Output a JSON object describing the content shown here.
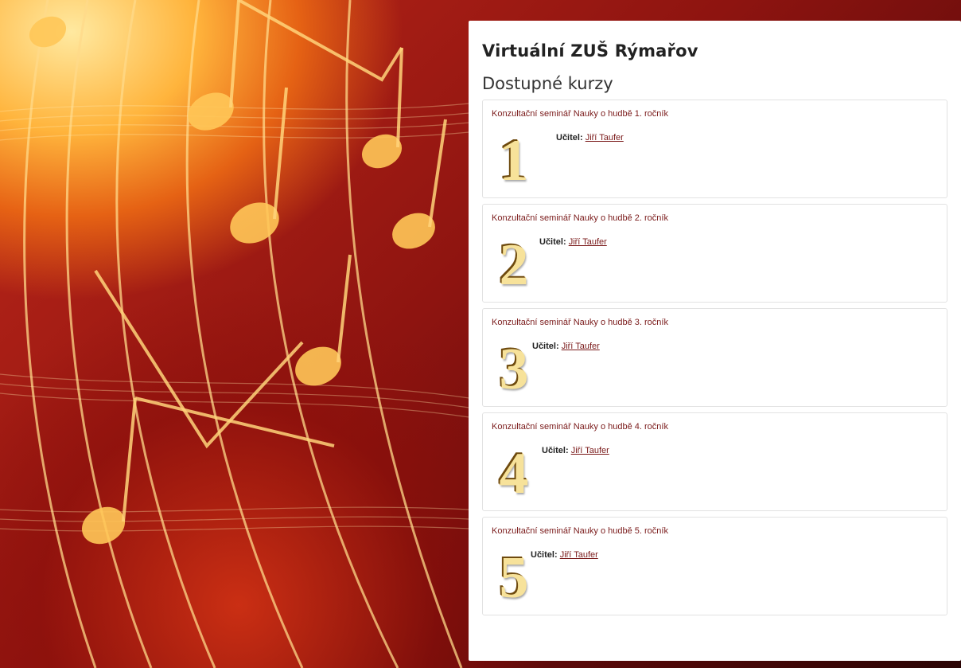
{
  "site": {
    "title": "Virtuální ZUŠ Rýmařov"
  },
  "section": {
    "title": "Dostupné kurzy"
  },
  "courses": [
    {
      "name": "Konzultační seminář Nauky o hudbě 1. ročník",
      "image_numeral": "1",
      "teacher_label": "Učitel:",
      "teacher_name": "Jiří Taufer"
    },
    {
      "name": "Konzultační seminář Nauky o hudbě 2. ročník",
      "image_numeral": "2",
      "teacher_label": "Učitel:",
      "teacher_name": "Jiří Taufer"
    },
    {
      "name": "Konzultační seminář Nauky o hudbě 3. ročník",
      "image_numeral": "3",
      "teacher_label": "Učitel:",
      "teacher_name": "Jiří Taufer"
    },
    {
      "name": "Konzultační seminář Nauky o hudbě 4. ročník",
      "image_numeral": "4",
      "teacher_label": "Učitel:",
      "teacher_name": "Jiří Taufer"
    },
    {
      "name": "Konzultační seminář Nauky o hudbě 5. ročník",
      "image_numeral": "5",
      "teacher_label": "Učitel:",
      "teacher_name": "Jiří Taufer"
    }
  ],
  "colors": {
    "link": "#7a1a1a",
    "background_warm": "#ffb43c",
    "background_dark": "#5c0a0a",
    "numeral_gold": "#c9962e"
  }
}
